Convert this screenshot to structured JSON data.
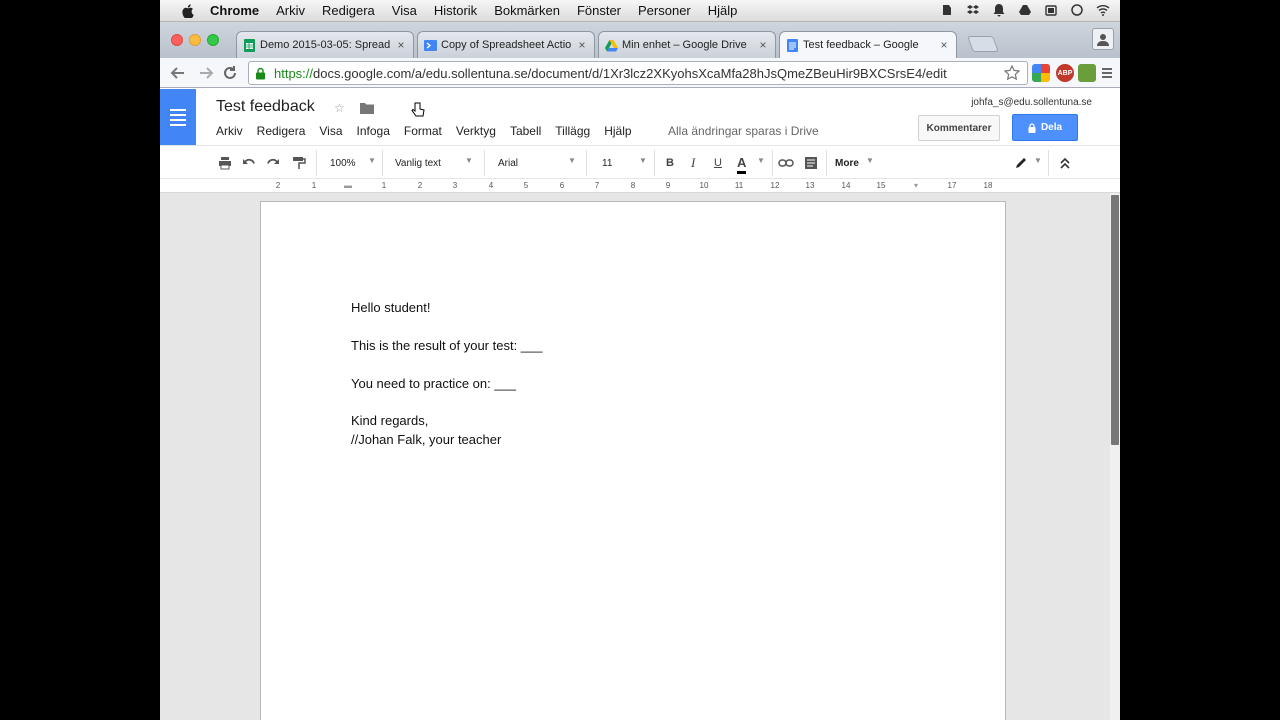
{
  "mac_menu": {
    "items": [
      "Chrome",
      "Arkiv",
      "Redigera",
      "Visa",
      "Historik",
      "Bokmärken",
      "Fönster",
      "Personer",
      "Hjälp"
    ]
  },
  "tabs": [
    {
      "title": "Demo 2015-03-05: Spread"
    },
    {
      "title": "Copy of Spreadsheet Actio"
    },
    {
      "title": "Min enhet – Google Drive"
    },
    {
      "title": "Test feedback – Google"
    }
  ],
  "omnibox": {
    "scheme": "https://",
    "rest": "docs.google.com/a/edu.sollentuna.se/document/d/1Xr3lcz2XKyohsXcaMfa28hJsQmeZBeuHir9BXCSrsE4/edit"
  },
  "extensions": {
    "abp": "ABP"
  },
  "docs": {
    "title": "Test feedback",
    "menu": [
      "Arkiv",
      "Redigera",
      "Visa",
      "Infoga",
      "Format",
      "Verktyg",
      "Tabell",
      "Tillägg",
      "Hjälp"
    ],
    "save_status": "Alla ändringar sparas i Drive",
    "account": "johfa_s@edu.sollentuna.se",
    "comments_label": "Kommentarer",
    "share_label": "Dela"
  },
  "format_toolbar": {
    "zoom": "100%",
    "style": "Vanlig text",
    "font": "Arial",
    "size": "11",
    "bold": "B",
    "italic": "I",
    "underline": "U",
    "text_color": "A",
    "more": "More"
  },
  "ruler": {
    "ticks": [
      "2",
      "1",
      "1",
      "2",
      "3",
      "4",
      "5",
      "6",
      "7",
      "8",
      "9",
      "10",
      "11",
      "12",
      "13",
      "14",
      "15",
      "16",
      "17",
      "18"
    ]
  },
  "document": {
    "lines": [
      "Hello student!",
      "This is the result of your test: ___",
      "You need to practice on: ___",
      "Kind regards,",
      "//Johan Falk, your teacher"
    ]
  },
  "colors": {
    "docs_blue": "#4285f4",
    "share_blue": "#4d90fe",
    "secure_green": "#1a8a1a"
  }
}
